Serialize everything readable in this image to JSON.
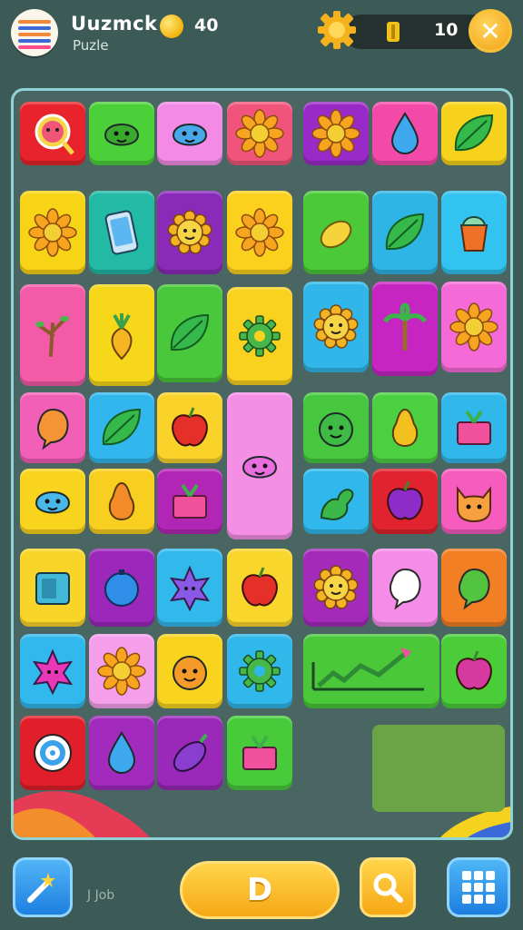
{
  "header": {
    "title": "Uuzmck",
    "subtitle": "Puzle",
    "coins": "40",
    "energy": "10",
    "logo_icon": "striped-ball-logo",
    "coin_icon": "coin-icon",
    "settings_icon": "gear-icon",
    "energy_icon": "battery-icon",
    "close_icon": "close-icon"
  },
  "board": {
    "border_color": "#8fd3d6",
    "tiles": [
      {
        "name": "tile-pink-face",
        "color": "#e8232b",
        "icon": "face-badge"
      },
      {
        "name": "tile-green-blob",
        "color": "#4cd03a",
        "icon": "blob"
      },
      {
        "name": "tile-blue-bird",
        "color": "#f28ae6",
        "icon": "blob"
      },
      {
        "name": "tile-flower-branch",
        "color": "#f0547a",
        "icon": "flower"
      },
      {
        "name": "tile-yellow-flower",
        "color": "#9a2ac8",
        "icon": "flower"
      },
      {
        "name": "tile-blue-ornament",
        "color": "#f34aa9",
        "icon": "drop"
      },
      {
        "name": "tile-lime-leaf",
        "color": "#f7d21d",
        "icon": "leaf"
      },
      {
        "name": "tile-sun-flower",
        "color": "#f8d417",
        "icon": "flower"
      },
      {
        "name": "tile-phone",
        "color": "#22b9a5",
        "icon": "phone"
      },
      {
        "name": "tile-sun-face",
        "color": "#8a2ab8",
        "icon": "sun"
      },
      {
        "name": "tile-red-flower",
        "color": "#fbd11e",
        "icon": "flower"
      },
      {
        "name": "tile-lemon",
        "color": "#4cc939",
        "icon": "lemon"
      },
      {
        "name": "tile-leaf",
        "color": "#2fb4e6",
        "icon": "leaf"
      },
      {
        "name": "tile-cup",
        "color": "#33c3f0",
        "icon": "cup"
      },
      {
        "name": "tile-twig",
        "color": "#f35aa8",
        "icon": "twig"
      },
      {
        "name": "tile-pineapple",
        "color": "#f6d719",
        "icon": "pineapple"
      },
      {
        "name": "tile-big-leaf",
        "color": "#48c83a",
        "icon": "leaf"
      },
      {
        "name": "tile-gear-green",
        "color": "#f9d21f",
        "icon": "gear"
      },
      {
        "name": "tile-green-virus",
        "color": "#30b6e8",
        "icon": "sun"
      },
      {
        "name": "tile-palm",
        "color": "#c625c2",
        "icon": "palm"
      },
      {
        "name": "tile-orange-flower",
        "color": "#f46bd7",
        "icon": "flower"
      },
      {
        "name": "tile-orange-balloon",
        "color": "#f15fb6",
        "icon": "balloon"
      },
      {
        "name": "tile-green-leaf",
        "color": "#31b7ee",
        "icon": "leaf"
      },
      {
        "name": "tile-red-apple",
        "color": "#f9d22a",
        "icon": "apple"
      },
      {
        "name": "tile-pink-slime",
        "color": "#f58ee5",
        "icon": "blob"
      },
      {
        "name": "tile-green-smile",
        "color": "#46c73f",
        "icon": "face"
      },
      {
        "name": "tile-yellow-pear",
        "color": "#4bd042",
        "icon": "pear"
      },
      {
        "name": "tile-pink-gift",
        "color": "#31b8ea",
        "icon": "gift"
      },
      {
        "name": "tile-blue-blob",
        "color": "#f9d41e",
        "icon": "blob"
      },
      {
        "name": "tile-orange-fruit",
        "color": "#f8cf20",
        "icon": "pear"
      },
      {
        "name": "tile-gift-box",
        "color": "#b226b5",
        "icon": "gift"
      },
      {
        "name": "tile-pink-star",
        "color": "#f58ee5",
        "icon": "star"
      },
      {
        "name": "tile-green-dino",
        "color": "#30b8ec",
        "icon": "dino"
      },
      {
        "name": "tile-purple-beet",
        "color": "#e1232f",
        "icon": "apple"
      },
      {
        "name": "tile-orange-cat",
        "color": "#f55cbd",
        "icon": "cat"
      },
      {
        "name": "tile-blue-box",
        "color": "#f9d52a",
        "icon": "box"
      },
      {
        "name": "tile-blue-ball",
        "color": "#9b28ba",
        "icon": "ball"
      },
      {
        "name": "tile-purple-star",
        "color": "#31b9ec",
        "icon": "star"
      },
      {
        "name": "tile-red-cherry",
        "color": "#f9d62c",
        "icon": "apple"
      },
      {
        "name": "tile-sun-smile",
        "color": "#a42ab9",
        "icon": "sun"
      },
      {
        "name": "tile-white-balloon",
        "color": "#f58ce7",
        "icon": "balloon"
      },
      {
        "name": "tile-green-bubble",
        "color": "#f27f23",
        "icon": "balloon"
      },
      {
        "name": "tile-pink-splat",
        "color": "#31b8ec",
        "icon": "star"
      },
      {
        "name": "tile-purple-flower",
        "color": "#f59fea",
        "icon": "flower"
      },
      {
        "name": "tile-orange-pumpkin",
        "color": "#f8d41f",
        "icon": "face"
      },
      {
        "name": "tile-green-ball",
        "color": "#2fb8e9",
        "icon": "gear"
      },
      {
        "name": "tile-chart-rocket",
        "color": "#4ac839",
        "icon": "chart"
      },
      {
        "name": "tile-pink-radish",
        "color": "#4bcd3a",
        "icon": "apple"
      },
      {
        "name": "tile-target",
        "color": "#e11f2a",
        "icon": "target"
      },
      {
        "name": "tile-blue-bird-2",
        "color": "#a22abd",
        "icon": "drop"
      },
      {
        "name": "tile-eggplant",
        "color": "#9a28b8",
        "icon": "eggplant"
      },
      {
        "name": "tile-pink-present",
        "color": "#48cb3b",
        "icon": "gift"
      }
    ]
  },
  "footer": {
    "hint_label": "J Job",
    "main_button_label": "D",
    "left_icon": "magic-wand-icon",
    "search_icon": "magnifier-icon",
    "menu_icon": "grid-menu-icon"
  }
}
